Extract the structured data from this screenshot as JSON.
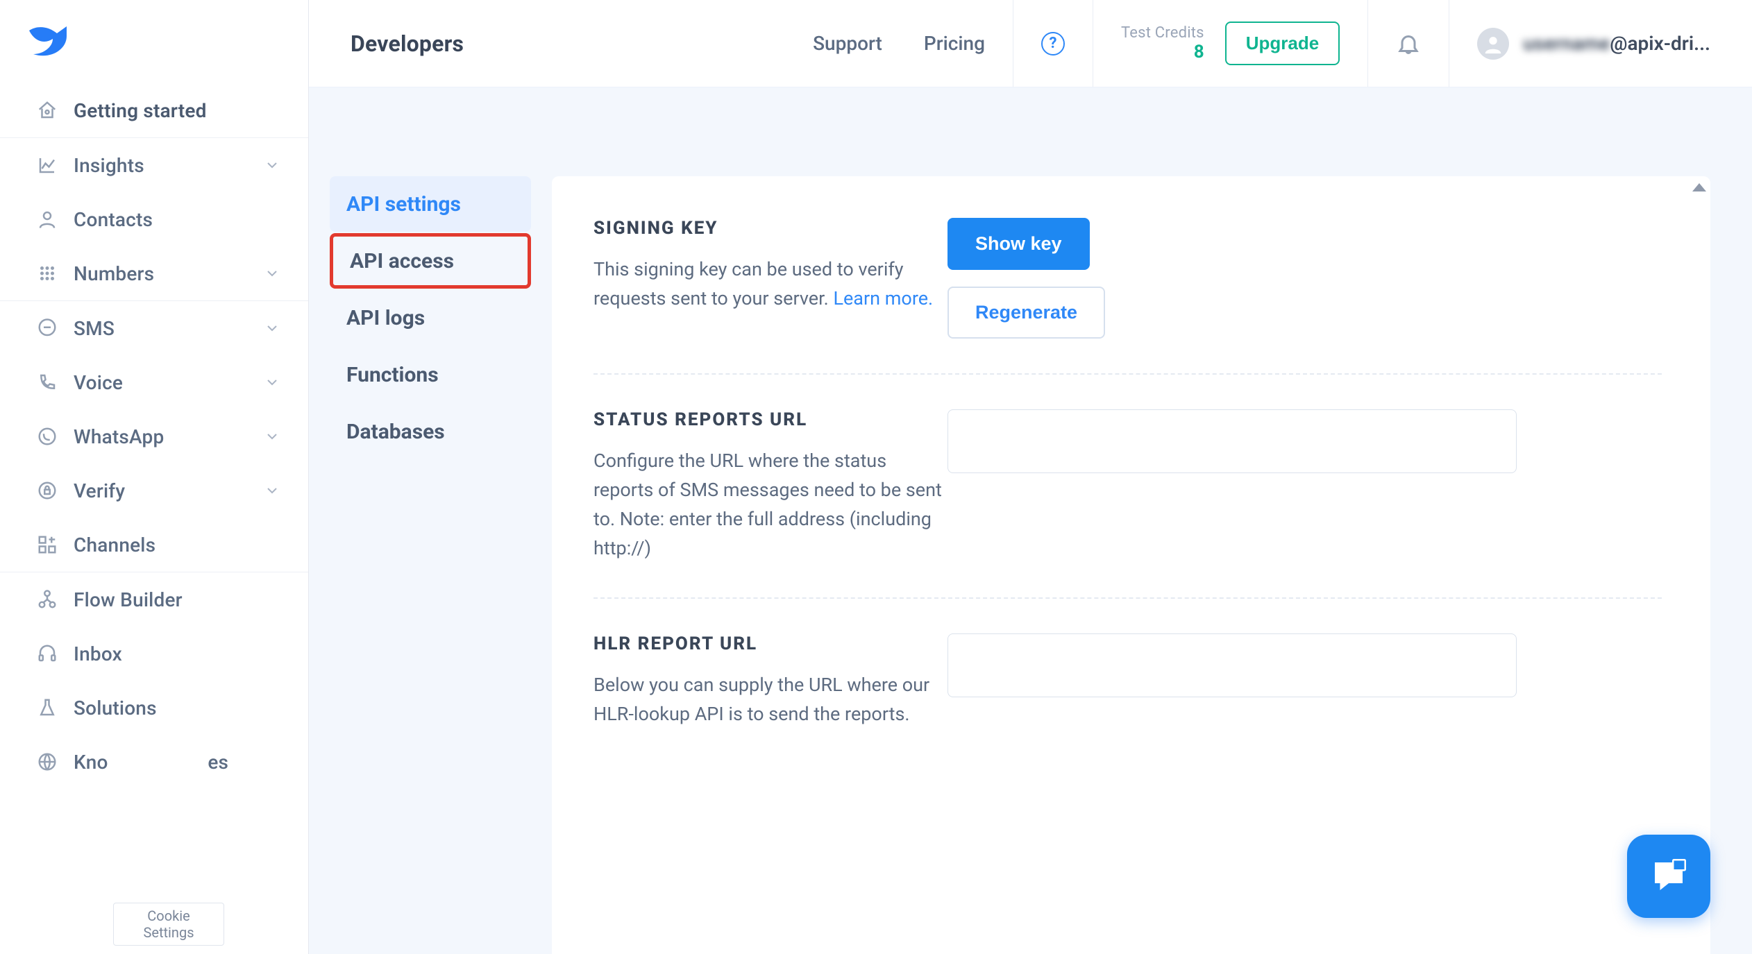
{
  "header": {
    "title": "Developers",
    "support": "Support",
    "pricing": "Pricing",
    "credits_label": "Test Credits",
    "credits_value": "8",
    "upgrade": "Upgrade",
    "user_email": "@apix-dri..."
  },
  "sidebar": {
    "getting_started": "Getting started",
    "insights": "Insights",
    "contacts": "Contacts",
    "numbers": "Numbers",
    "sms": "SMS",
    "voice": "Voice",
    "whatsapp": "WhatsApp",
    "verify": "Verify",
    "channels": "Channels",
    "flow_builder": "Flow Builder",
    "inbox": "Inbox",
    "solutions": "Solutions",
    "knowledge": "Kno",
    "knowledge_tail": "es"
  },
  "cookie": "Cookie Settings",
  "subnav": {
    "api_settings": "API settings",
    "api_access": "API access",
    "api_logs": "API logs",
    "functions": "Functions",
    "databases": "Databases"
  },
  "panel": {
    "signing_key": {
      "title": "SIGNING KEY",
      "desc_a": "This signing key can be used to verify requests sent to your server. ",
      "learn_more": "Learn more.",
      "show_key": "Show key",
      "regenerate": "Regenerate"
    },
    "status_reports": {
      "title": "STATUS REPORTS URL",
      "desc": "Configure the URL where the status reports of SMS messages need to be sent to. Note: enter the full address (including http://)"
    },
    "hlr": {
      "title": "HLR REPORT URL",
      "desc": "Below you can supply the URL where our HLR-lookup API is to send the reports."
    }
  }
}
